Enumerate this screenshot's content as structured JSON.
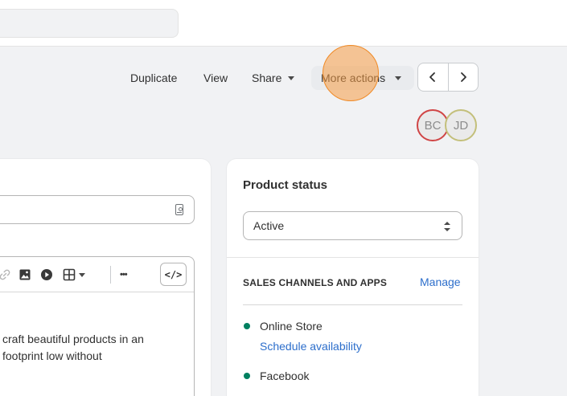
{
  "header": {
    "actions": {
      "duplicate": "Duplicate",
      "view": "View",
      "share": "Share",
      "more_actions": "More actions"
    },
    "collaborators": [
      "BC",
      "JD"
    ]
  },
  "editor": {
    "toolbar": {
      "code_label": "</>",
      "more_label": "•••"
    },
    "description_lines": [
      "craft beautiful products in an",
      "footprint low without"
    ]
  },
  "product_status": {
    "title": "Product status",
    "selected": "Active",
    "channels_heading": "SALES CHANNELS AND APPS",
    "manage_label": "Manage",
    "channels": [
      {
        "name": "Online Store",
        "link": "Schedule availability"
      },
      {
        "name": "Facebook"
      }
    ]
  },
  "colors": {
    "link": "#2c6ecb",
    "channel_active": "#008060",
    "click_ring": "#f08a26",
    "avatar_bc_ring": "#d04545",
    "avatar_jd_ring": "#c3bf7a"
  }
}
